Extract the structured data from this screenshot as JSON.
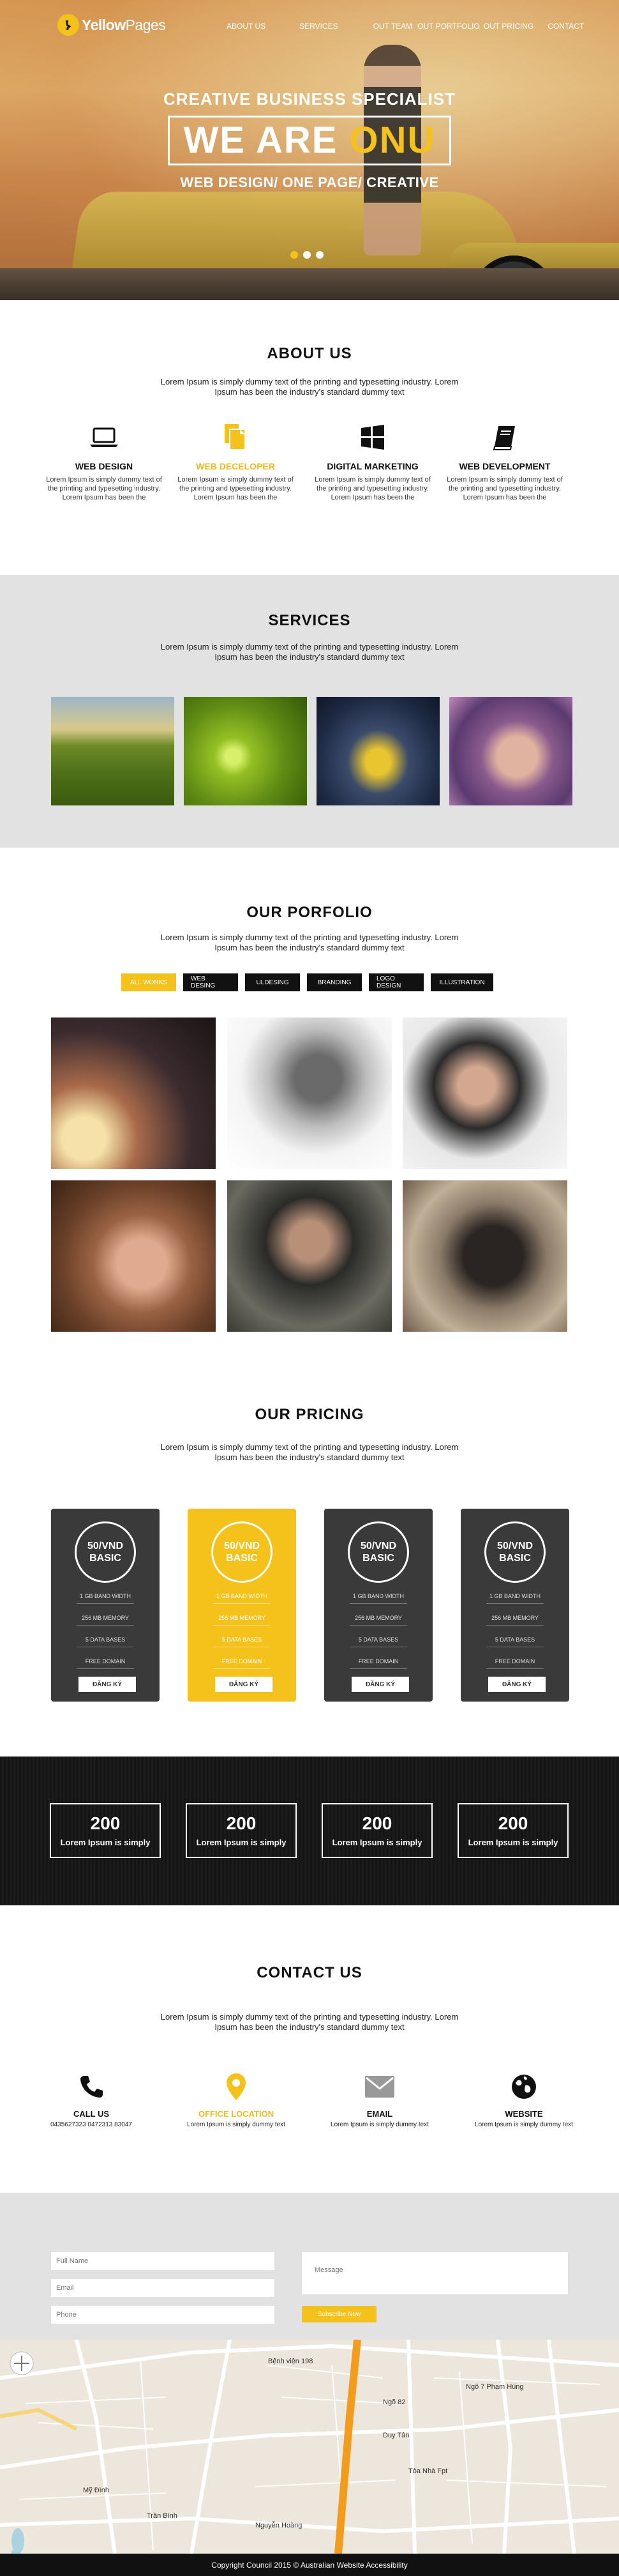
{
  "nav": {
    "logo_yellow": "Yellow",
    "logo_pages": "Pages",
    "items": [
      "ABOUT US",
      "SERVICES",
      "OUT TEAM",
      "OUT PORTFOLIO",
      "OUT PRICING",
      "CONTACT"
    ]
  },
  "hero": {
    "subtitle": "CREATIVE BUSINESS SPECIALIST",
    "big_prefix": "WE ARE ",
    "big_highlight": "ONU",
    "tagline": "WEB DESIGN/ ONE PAGE/ CREATIVE"
  },
  "about": {
    "title": "ABOUT US",
    "text": "Lorem Ipsum is simply dummy text of the printing and typesetting industry. Lorem Ipsum has been the industry's standard dummy text",
    "items": [
      {
        "icon": "laptop-icon",
        "title": "WEB DESIGN",
        "text": "Lorem Ipsum is simply dummy text of the printing and typesetting industry. Lorem Ipsum has been the"
      },
      {
        "icon": "documents-icon",
        "title": "WEB DECELOPER",
        "text": "Lorem Ipsum is simply dummy text of the printing and typesetting industry. Lorem Ipsum has been the"
      },
      {
        "icon": "windows-icon",
        "title": "DIGITAL MARKETING",
        "text": "Lorem Ipsum is simply dummy text of the printing and typesetting industry. Lorem Ipsum has been the"
      },
      {
        "icon": "book-icon",
        "title": "WEB DEVELOPMENT",
        "text": "Lorem Ipsum is simply dummy text of the printing and typesetting industry. Lorem Ipsum has been the"
      }
    ]
  },
  "services": {
    "title": "SERVICES",
    "text": "Lorem Ipsum is simply dummy text of the printing and typesetting industry. Lorem Ipsum has been the industry's standard dummy text"
  },
  "portfolio": {
    "title": "OUR  PORFOLIO",
    "text": "Lorem Ipsum is simply dummy text of the printing and typesetting industry. Lorem Ipsum has been the industry's standard dummy text",
    "filters": [
      "ALL WORKS",
      "WEB DESING",
      "ULDESING",
      "BRANDING",
      "LOGO DESIGN",
      "ILLUSTRATION"
    ]
  },
  "pricing": {
    "title": "OUR  PRICING",
    "text": "Lorem Ipsum is simply dummy text of the printing and typesetting industry. Lorem Ipsum has been the industry's standard dummy text",
    "plans": [
      {
        "price": "50/VND",
        "name": "BASIC",
        "features": [
          "1 GB BAND WIDTH",
          "256 MB MEMORY",
          "5 DATA BASES",
          "FREE DOMAIN"
        ],
        "button": "ĐĂNG KÝ"
      },
      {
        "price": "50/VND",
        "name": "BASIC",
        "features": [
          "1 GB BAND WIDTH",
          "256 MB MEMORY",
          "5 DATA BASES",
          "FREE DOMAIN"
        ],
        "button": "ĐĂNG KÝ"
      },
      {
        "price": "50/VND",
        "name": "BASIC",
        "features": [
          "1 GB BAND WIDTH",
          "256 MB MEMORY",
          "5 DATA BASES",
          "FREE DOMAIN"
        ],
        "button": "ĐĂNG KÝ"
      },
      {
        "price": "50/VND",
        "name": "BASIC",
        "features": [
          "1 GB BAND WIDTH",
          "256 MB MEMORY",
          "5 DATA BASES",
          "FREE DOMAIN"
        ],
        "button": "ĐĂNG KÝ"
      }
    ]
  },
  "stats": [
    {
      "value": "200",
      "label": "Lorem Ipsum is simply"
    },
    {
      "value": "200",
      "label": "Lorem Ipsum is simply"
    },
    {
      "value": "200",
      "label": "Lorem Ipsum is simply"
    },
    {
      "value": "200",
      "label": "Lorem Ipsum is simply"
    }
  ],
  "contact": {
    "title": "CONTACT US",
    "text": "Lorem Ipsum is simply dummy text of the printing and typesetting industry. Lorem Ipsum has been the industry's standard dummy text",
    "items": [
      {
        "icon": "phone-icon",
        "title": "CALL US",
        "text": "0435627323 0472313 83047"
      },
      {
        "icon": "map-pin-icon",
        "title": "OFFICE LOCATION",
        "text": "Lorem Ipsum is simply dummy text"
      },
      {
        "icon": "mail-icon",
        "title": "EMAIL",
        "text": "Lorem Ipsum is simply dummy text"
      },
      {
        "icon": "globe-icon",
        "title": "WEBSITE",
        "text": "Lorem Ipsum is simply dummy text"
      }
    ]
  },
  "form": {
    "name_placeholder": "Full Name",
    "email_placeholder": "Email",
    "phone_placeholder": "Phone",
    "message_placeholder": "Message",
    "submit": "Subscribe Now"
  },
  "map": {
    "labels": [
      "Ngõ 7 Phạm Hùng",
      "Duy Tân",
      "Tòa Nhà Fpt",
      "Nguyễn Hoàng",
      "Mỹ Đình",
      "Trần Bình",
      "Bệnh viện 198",
      "Ngõ 82"
    ]
  },
  "footer": {
    "text": "Copyright Council 2015 © Australian Website Accessibility"
  },
  "colors": {
    "accent": "#f4c21b",
    "dark": "#3b3a3b",
    "grey_bg": "#e3e2e3"
  }
}
